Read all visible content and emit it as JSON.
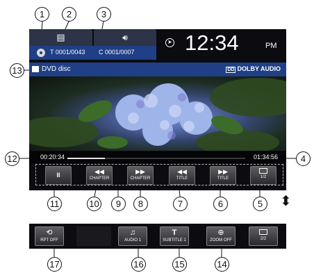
{
  "screen": {
    "track_info": "T 0001/0043",
    "chapter_info": "C 0001/0007",
    "clock_time": "12:34",
    "clock_ampm": "PM",
    "source_label": "DVD disc",
    "audio_logo": "DOLBY AUDIO",
    "elapsed_time": "00:20:34",
    "total_time": "01:34:56",
    "progress_fraction": 0.21
  },
  "controls_page1": {
    "pause_icon": "II",
    "chapter_prev_icon": "◀◀",
    "chapter_prev_label": "CHAPTER",
    "chapter_next_icon": "▶▶",
    "chapter_next_label": "CHAPTER",
    "title_prev_icon": "◀◀",
    "title_prev_label": "TITLE",
    "title_next_icon": "▶▶",
    "title_next_label": "TITLE",
    "page_label": "1/2"
  },
  "controls_page2": {
    "repeat_label": "RPT OFF",
    "audio_label": "AUDIO 1",
    "subtitle_label": "SUBTITLE 1",
    "zoom_label": "ZOOM OFF",
    "page_label": "2/2"
  },
  "callouts": [
    "1",
    "2",
    "3",
    "4",
    "5",
    "6",
    "7",
    "8",
    "9",
    "10",
    "11",
    "12",
    "13",
    "14",
    "15",
    "16",
    "17"
  ],
  "icons": [
    "disc-icon",
    "menu-icon",
    "speaker-icon",
    "navigation-icon",
    "pause-icon",
    "skip-back-icon",
    "skip-forward-icon",
    "page-toggle-icon",
    "repeat-icon",
    "music-note-icon",
    "subtitle-icon",
    "zoom-icon",
    "updown-arrow-icon"
  ],
  "colors": {
    "info_bar": "#1f3f86",
    "tab": "#2d3447",
    "screen_bg": "#0b0b10"
  }
}
